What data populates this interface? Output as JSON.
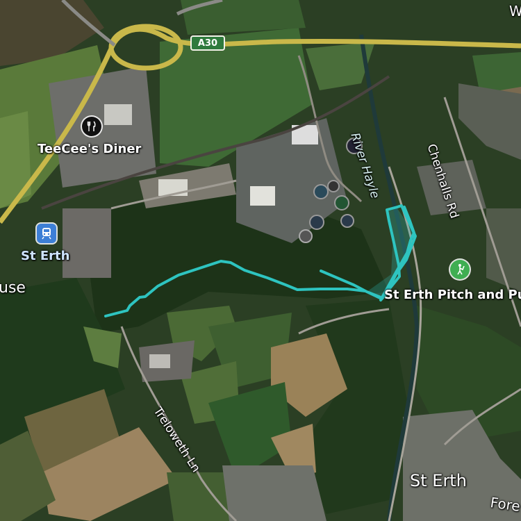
{
  "map": {
    "style": "satellite",
    "accent_color": "#2ec4c0"
  },
  "road_shield": {
    "label": "A30",
    "color": "#2f7a3d"
  },
  "places": {
    "diner": {
      "name": "TeeCee's Diner",
      "icon": "restaurant-icon"
    },
    "station": {
      "name": "St Erth",
      "icon": "train-station-icon"
    },
    "pitch_putt": {
      "name": "St Erth Pitch and Pu",
      "icon": "golf-icon"
    },
    "village": {
      "name": "St Erth"
    },
    "left_edge": {
      "name": "use"
    },
    "top_edge": {
      "name": "W"
    },
    "bottom_edge": {
      "name": "Fore"
    }
  },
  "roads": {
    "chenhalls": "Chenhalls Rd",
    "treloweth": "Treloweth Ln"
  },
  "waterways": {
    "river": "River Hayle"
  }
}
